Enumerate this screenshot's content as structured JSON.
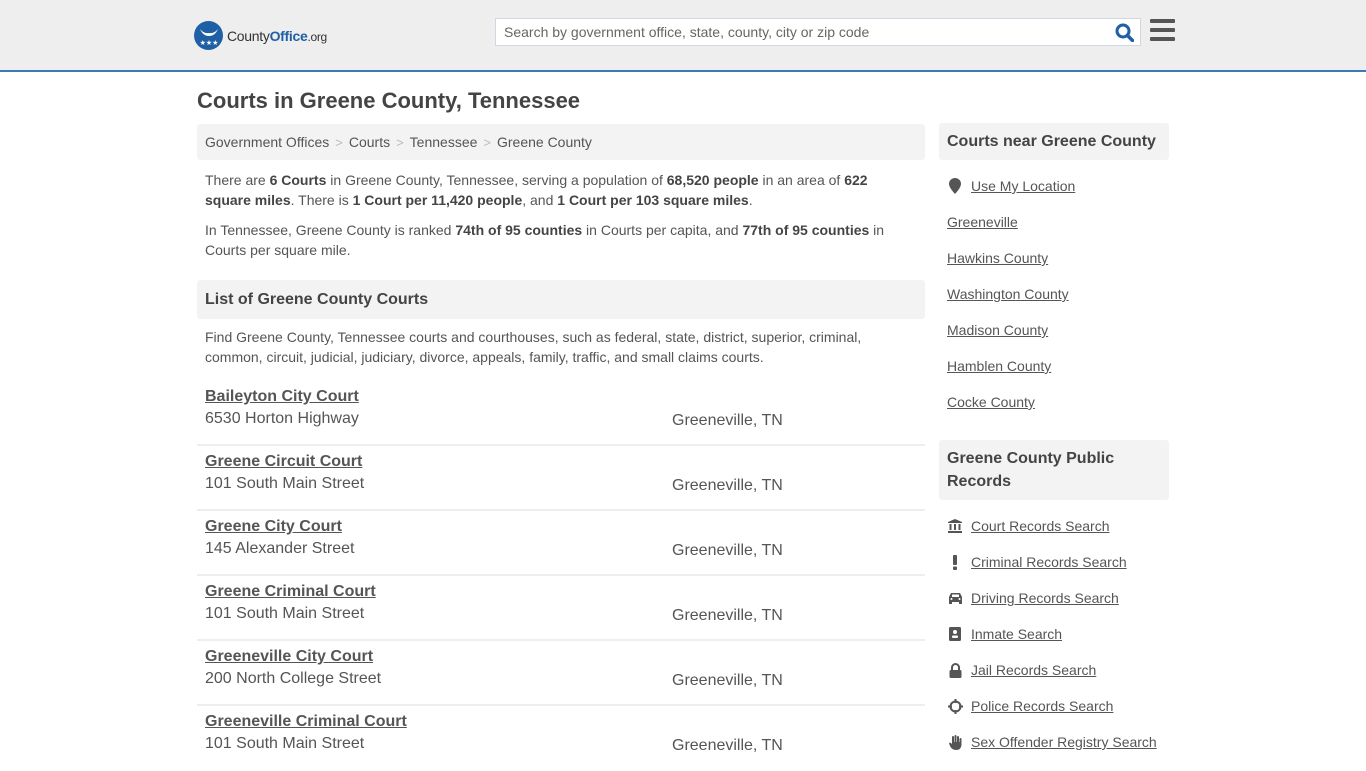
{
  "header": {
    "logo": {
      "name_part1": "County",
      "name_part2": "Office",
      "tld": ".org"
    },
    "search": {
      "placeholder": "Search by government office, state, county, city or zip code",
      "value": ""
    },
    "colors": {
      "accent": "#3a7ab5",
      "brand": "#1f5fa6"
    }
  },
  "page": {
    "title": "Courts in Greene County, Tennessee",
    "breadcrumb": [
      "Government Offices",
      "Courts",
      "Tennessee",
      "Greene County"
    ]
  },
  "intro": {
    "p1": {
      "t1": "There are ",
      "b1": "6 Courts",
      "t2": " in Greene County, Tennessee, serving a population of ",
      "b2": "68,520 people",
      "t3": " in an area of ",
      "b3": "622 square miles",
      "t4": ". There is ",
      "b4": "1 Court per 11,420 people",
      "t5": ", and ",
      "b5": "1 Court per 103 square miles",
      "t6": "."
    },
    "p2": {
      "t1": "In Tennessee, Greene County is ranked ",
      "b1": "74th of 95 counties",
      "t2": " in Courts per capita, and ",
      "b2": "77th of 95 counties",
      "t3": " in Courts per square mile."
    }
  },
  "list": {
    "heading": "List of Greene County Courts",
    "description": "Find Greene County, Tennessee courts and courthouses, such as federal, state, district, superior, criminal, common, circuit, judicial, judiciary, divorce, appeals, family, traffic, and small claims courts.",
    "courts": [
      {
        "name": "Baileyton City Court",
        "address": "6530 Horton Highway",
        "city": "Greeneville, TN"
      },
      {
        "name": "Greene Circuit Court",
        "address": "101 South Main Street",
        "city": "Greeneville, TN"
      },
      {
        "name": "Greene City Court",
        "address": "145 Alexander Street",
        "city": "Greeneville, TN"
      },
      {
        "name": "Greene Criminal Court",
        "address": "101 South Main Street",
        "city": "Greeneville, TN"
      },
      {
        "name": "Greeneville City Court",
        "address": "200 North College Street",
        "city": "Greeneville, TN"
      },
      {
        "name": "Greeneville Criminal Court",
        "address": "101 South Main Street",
        "city": "Greeneville, TN"
      }
    ]
  },
  "sidebar": {
    "nearby": {
      "heading": "Courts near Greene County",
      "use_location": {
        "label": "Use My Location",
        "icon": "map-marker-icon"
      },
      "items": [
        "Greeneville",
        "Hawkins County",
        "Washington County",
        "Madison County",
        "Hamblen County",
        "Cocke County"
      ]
    },
    "records": {
      "heading": "Greene County Public Records",
      "items": [
        {
          "label": "Court Records Search",
          "icon": "courthouse-icon"
        },
        {
          "label": "Criminal Records Search",
          "icon": "exclamation-icon"
        },
        {
          "label": "Driving Records Search",
          "icon": "car-icon"
        },
        {
          "label": "Inmate Search",
          "icon": "id-badge-icon"
        },
        {
          "label": "Jail Records Search",
          "icon": "lock-icon"
        },
        {
          "label": "Police Records Search",
          "icon": "crosshairs-icon"
        },
        {
          "label": "Sex Offender Registry Search",
          "icon": "hand-icon"
        }
      ]
    }
  }
}
